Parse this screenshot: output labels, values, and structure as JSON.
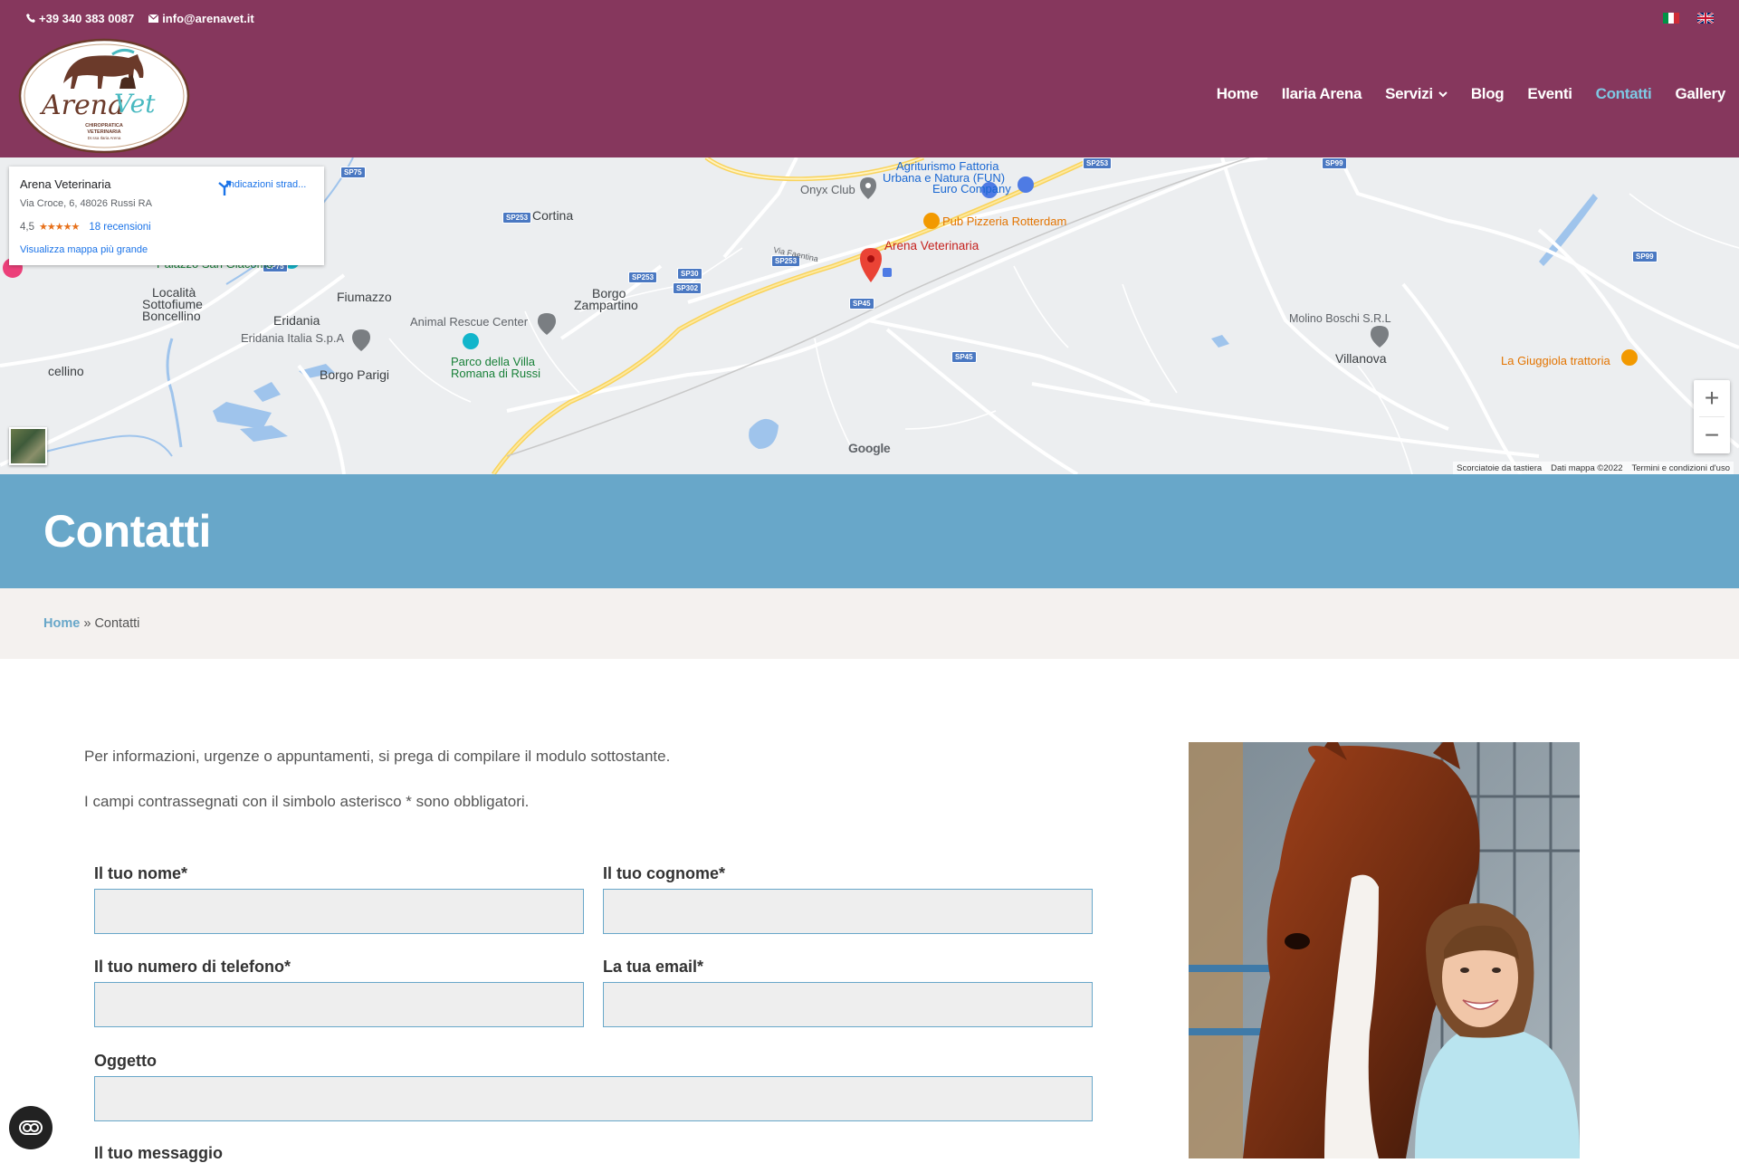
{
  "header": {
    "phone": "+39 340 383 0087",
    "email": "info@arenavet.it",
    "logo_text": {
      "arena": "Arena",
      "vet": "Vet",
      "line1": "CHIROPRATICA",
      "line2": "VETERINARIA",
      "line3": "Dr.ssa Ilaria Arena"
    },
    "nav": [
      {
        "label": "Home"
      },
      {
        "label": "Ilaria Arena"
      },
      {
        "label": "Servizi"
      },
      {
        "label": "Blog"
      },
      {
        "label": "Eventi"
      },
      {
        "label": "Contatti",
        "active": true
      },
      {
        "label": "Gallery"
      }
    ],
    "colors": {
      "bar": "#86375d",
      "active": "#7ec8e3"
    }
  },
  "map": {
    "card": {
      "name": "Arena Veterinaria",
      "address": "Via Croce, 6, 48026 Russi RA",
      "rating": "4,5",
      "stars": "★★★★★",
      "reviews": "18 recensioni",
      "directions": "Indicazioni strad...",
      "bigger_map": "Visualizza mappa più grande"
    },
    "labels": {
      "cortina": "Cortina",
      "fiumazzo": "Fiumazzo",
      "eridania": "Eridania",
      "borgo_zampartino_1": "Borgo",
      "borgo_zampartino_2": "Zampartino",
      "borgo_parigi": "Borgo Parigi",
      "localita_1": "Località",
      "localita_2": "Sottofiume",
      "localita_3": "Boncellino",
      "cellino": "cellino",
      "villanova": "Villanova",
      "palazzo": "Palazzo San Giacomo",
      "eridania_italia": "Eridania Italia S.p.A",
      "animal_rescue": "Animal Rescue Center",
      "parco_1": "Parco della Villa",
      "parco_2": "Romana di Russi",
      "onyx": "Onyx Club",
      "euro_company": "Euro Company",
      "agriturismo_1": "Agriturismo Fattoria",
      "agriturismo_2": "Urbana e Natura (FUN)",
      "pub": "Pub Pizzeria Rotterdam",
      "arena_vet": "Arena Veterinaria",
      "via_faentina": "Via Faentina",
      "molino": "Molino Boschi S.R.L",
      "giuggiola": "La Giuggiola trattoria"
    },
    "shields": [
      "SP75",
      "SP253",
      "SP253",
      "SP30",
      "SP302",
      "SP253",
      "SP45",
      "SP45",
      "SP253",
      "SP99",
      "SP99",
      "SP75"
    ],
    "google": "Google",
    "footer": [
      "Scorciatoie da tastiera",
      "Dati mappa ©2022",
      "Termini e condizioni d'uso"
    ],
    "zoom_in": "+",
    "zoom_out": "−"
  },
  "page": {
    "title": "Contatti",
    "breadcrumb_home": "Home",
    "breadcrumb_sep": "»",
    "breadcrumb_current": "Contatti"
  },
  "content": {
    "intro1": "Per informazioni, urgenze o appuntamenti, si prega di compilare il modulo sottostante.",
    "intro2": "I campi contrassegnati con il simbolo asterisco * sono obbligatori.",
    "form": {
      "nome": "Il tuo nome*",
      "cognome": "Il tuo cognome*",
      "telefono": "Il tuo numero di telefono*",
      "email": "La tua email*",
      "oggetto": "Oggetto",
      "messaggio": "Il tuo messaggio"
    }
  }
}
